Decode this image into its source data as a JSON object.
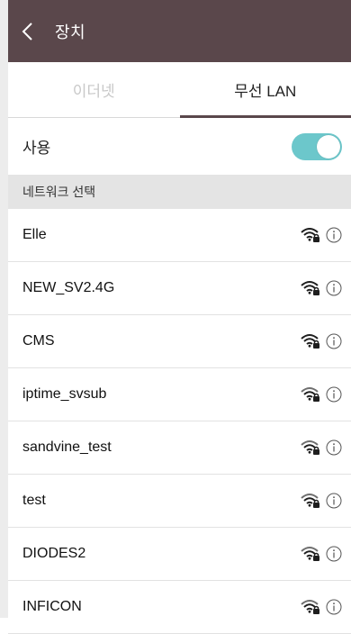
{
  "header": {
    "title": "장치"
  },
  "tabs": [
    {
      "label": "이더넷",
      "active": false
    },
    {
      "label": "무선 LAN",
      "active": true
    }
  ],
  "wireless": {
    "use_label": "사용",
    "enabled": true
  },
  "section": {
    "title": "네트워크 선택"
  },
  "networks": [
    {
      "ssid": "Elle",
      "strength": "strong",
      "secured": true
    },
    {
      "ssid": "NEW_SV2.4G",
      "strength": "strong",
      "secured": true
    },
    {
      "ssid": "CMS",
      "strength": "strong",
      "secured": true
    },
    {
      "ssid": "iptime_svsub",
      "strength": "medium",
      "secured": true
    },
    {
      "ssid": "sandvine_test",
      "strength": "medium",
      "secured": true
    },
    {
      "ssid": "test",
      "strength": "medium",
      "secured": true
    },
    {
      "ssid": "DIODES2",
      "strength": "medium",
      "secured": true
    },
    {
      "ssid": "INFICON",
      "strength": "medium",
      "secured": true
    }
  ],
  "colors": {
    "header": "#5a474b",
    "toggle_on": "#6cc7cb",
    "section_bg": "#e4e4e4"
  }
}
